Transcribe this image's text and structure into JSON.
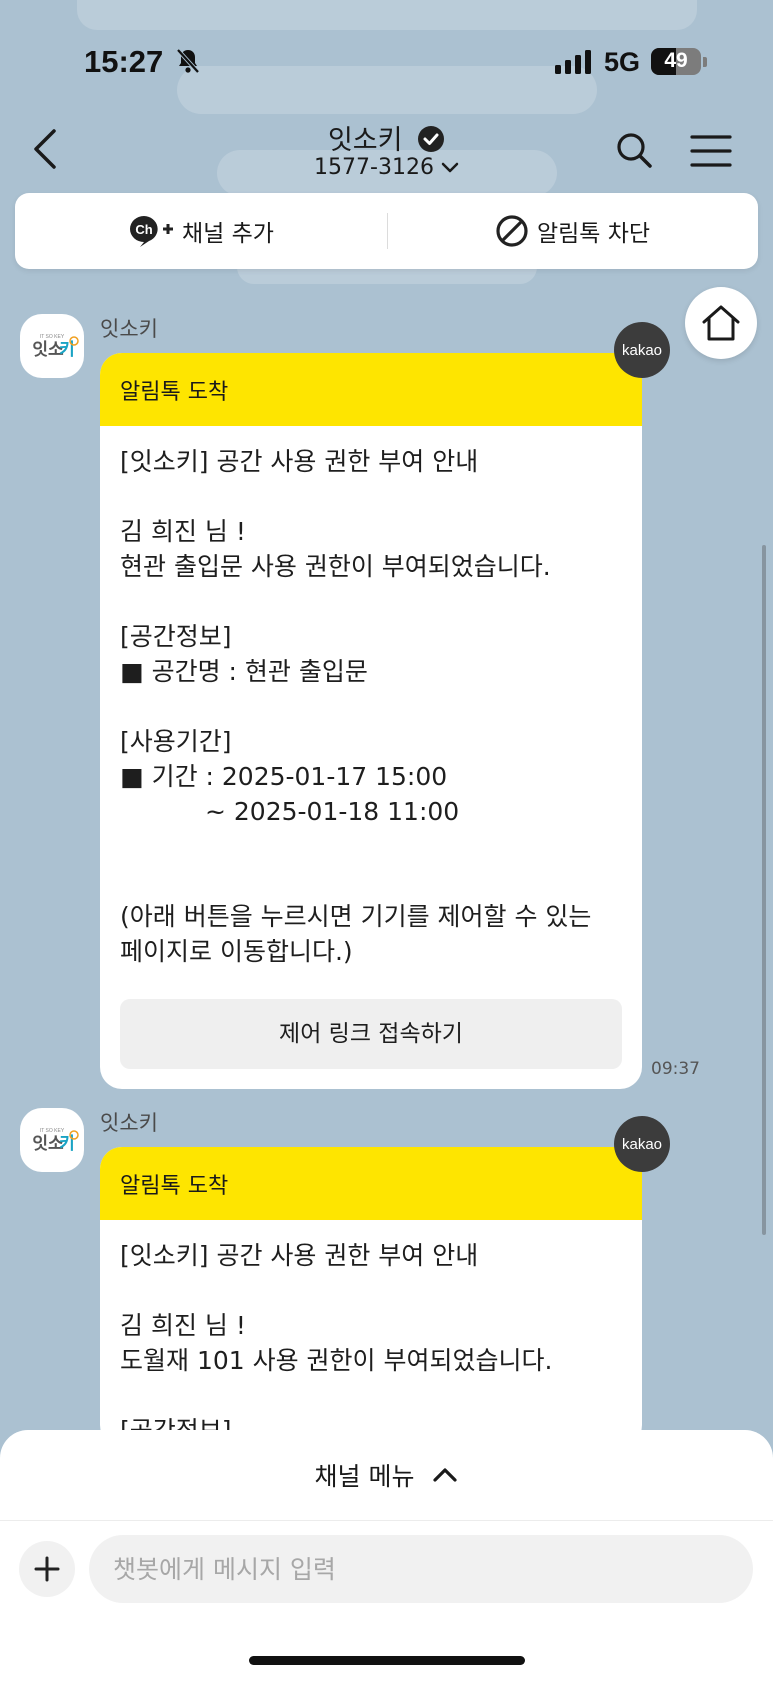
{
  "status_bar": {
    "time": "15:27",
    "network": "5G",
    "battery": "49",
    "battery_level": 0.49
  },
  "header": {
    "title": "잇소키",
    "phone": "1577-3126"
  },
  "channel_bar": {
    "add_channel": "채널 추가",
    "block_alimtalk": "알림톡 차단"
  },
  "messages": [
    {
      "sender": "잇소키",
      "header": "알림톡 도착",
      "lines": [
        "[잇소키] 공간 사용 권한 부여 안내",
        "",
        "김 희진 님 !",
        "현관 출입문 사용 권한이 부여되었습니다.",
        "",
        "[공간정보]",
        "■ 공간명 : 현관 출입문",
        "",
        "[사용기간]",
        "■ 기간 : 2025-01-17 15:00",
        "~ 2025-01-18 11:00",
        "",
        "",
        "(아래 버튼을 누르시면 기기를 제어할 수 있는",
        "페이지로 이동합니다.)"
      ],
      "button": "제어 링크 접속하기",
      "time": "09:37",
      "badge": "kakao"
    },
    {
      "sender": "잇소키",
      "header": "알림톡 도착",
      "lines": [
        "[잇소키] 공간 사용 권한 부여 안내",
        "",
        "김 희진 님 !",
        "도월재 101 사용 권한이 부여되었습니다.",
        "",
        "[공간정보]"
      ],
      "badge": "kakao"
    }
  ],
  "bottom": {
    "channel_menu": "채널 메뉴",
    "input_placeholder": "챗봇에게 메시지 입력"
  },
  "icons": {
    "back": "chevron-left-icon",
    "search": "search-icon",
    "menu": "hamburger-icon",
    "home": "home-icon",
    "plus": "plus-icon"
  },
  "colors": {
    "background": "#abc1d1",
    "notice_header": "#fee500",
    "badge": "#3c3c3c"
  }
}
